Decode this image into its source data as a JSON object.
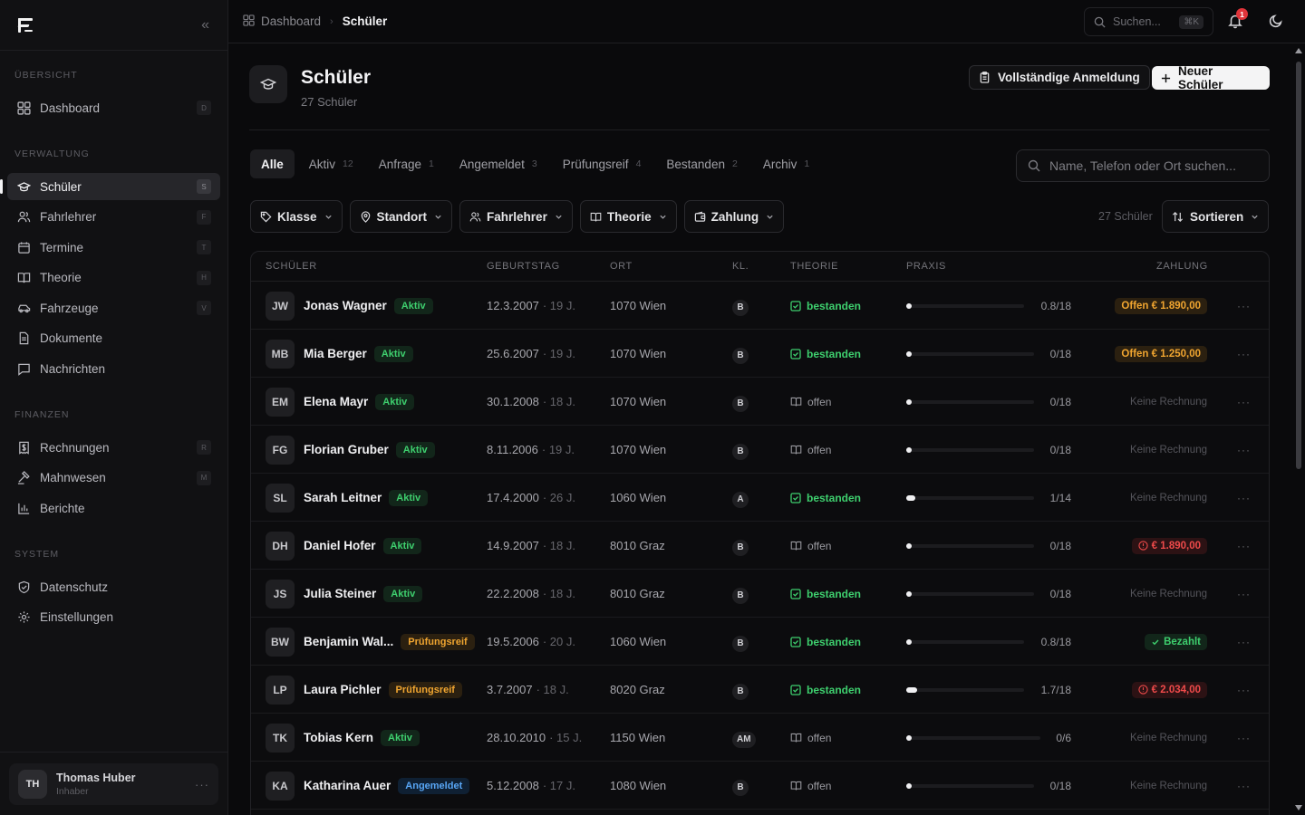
{
  "sidebar": {
    "sections": [
      {
        "label": "ÜBERSICHT",
        "items": [
          {
            "label": "Dashboard",
            "kbd": "D",
            "icon": "dashboard-icon"
          }
        ]
      },
      {
        "label": "VERWALTUNG",
        "items": [
          {
            "label": "Schüler",
            "kbd": "S",
            "icon": "graduation-cap-icon",
            "active": true
          },
          {
            "label": "Fahrlehrer",
            "kbd": "F",
            "icon": "user-icon"
          },
          {
            "label": "Termine",
            "kbd": "T",
            "icon": "calendar-icon"
          },
          {
            "label": "Theorie",
            "kbd": "H",
            "icon": "book-icon"
          },
          {
            "label": "Fahrzeuge",
            "kbd": "V",
            "icon": "car-icon"
          },
          {
            "label": "Dokumente",
            "kbd": "",
            "icon": "document-icon"
          },
          {
            "label": "Nachrichten",
            "kbd": "",
            "icon": "message-icon"
          }
        ]
      },
      {
        "label": "FINANZEN",
        "items": [
          {
            "label": "Rechnungen",
            "kbd": "R",
            "icon": "receipt-icon"
          },
          {
            "label": "Mahnwesen",
            "kbd": "M",
            "icon": "gavel-icon"
          },
          {
            "label": "Berichte",
            "kbd": "",
            "icon": "bar-chart-icon"
          }
        ]
      },
      {
        "label": "SYSTEM",
        "items": [
          {
            "label": "Datenschutz",
            "kbd": "",
            "icon": "shield-icon"
          },
          {
            "label": "Einstellungen",
            "kbd": "",
            "icon": "gear-icon"
          }
        ]
      }
    ],
    "user": {
      "initials": "TH",
      "name": "Thomas Huber",
      "role": "Inhaber",
      "more": "···"
    }
  },
  "topbar": {
    "breadcrumb_root": "Dashboard",
    "breadcrumb_current": "Schüler",
    "search_placeholder": "Suchen...",
    "search_kbd": "⌘K",
    "notification_count": "1"
  },
  "page": {
    "title": "Schüler",
    "subtitle": "27 Schüler",
    "btn_full_registration": "Vollständige Anmeldung",
    "btn_new_student": "Neuer Schüler"
  },
  "tabs": [
    {
      "label": "Alle",
      "count": "",
      "active": true
    },
    {
      "label": "Aktiv",
      "count": "12"
    },
    {
      "label": "Anfrage",
      "count": "1"
    },
    {
      "label": "Angemeldet",
      "count": "3"
    },
    {
      "label": "Prüfungsreif",
      "count": "4"
    },
    {
      "label": "Bestanden",
      "count": "2"
    },
    {
      "label": "Archiv",
      "count": "1"
    }
  ],
  "search_main_placeholder": "Name, Telefon oder Ort suchen...",
  "filters": [
    "Klasse",
    "Standort",
    "Fahrlehrer",
    "Theorie",
    "Zahlung"
  ],
  "result_count": "27 Schüler",
  "sort_label": "Sortieren",
  "table": {
    "headers": [
      "SCHÜLER",
      "GEBURTSTAG",
      "ORT",
      "KL.",
      "THEORIE",
      "PRAXIS",
      "ZAHLUNG"
    ],
    "rows": [
      {
        "initials": "JW",
        "name": "Jonas Wagner",
        "status": "Aktiv",
        "status_type": "aktiv",
        "birth": "12.3.2007",
        "age": "· 19 J.",
        "ort": "1070 Wien",
        "kl": "B",
        "theorie": "bestanden",
        "theorie_ok": true,
        "praxis": "0.8/18",
        "praxis_progress": 0.044,
        "zahlung": "Offen € 1.890,00",
        "zahlung_type": "open"
      },
      {
        "initials": "MB",
        "name": "Mia Berger",
        "status": "Aktiv",
        "status_type": "aktiv",
        "birth": "25.6.2007",
        "age": "· 19 J.",
        "ort": "1070 Wien",
        "kl": "B",
        "theorie": "bestanden",
        "theorie_ok": true,
        "praxis": "0/18",
        "praxis_progress": 0,
        "zahlung": "Offen € 1.250,00",
        "zahlung_type": "open"
      },
      {
        "initials": "EM",
        "name": "Elena Mayr",
        "status": "Aktiv",
        "status_type": "aktiv",
        "birth": "30.1.2008",
        "age": "· 18 J.",
        "ort": "1070 Wien",
        "kl": "B",
        "theorie": "offen",
        "theorie_ok": false,
        "praxis": "0/18",
        "praxis_progress": 0,
        "zahlung": "Keine Rechnung",
        "zahlung_type": "none"
      },
      {
        "initials": "FG",
        "name": "Florian Gruber",
        "status": "Aktiv",
        "status_type": "aktiv",
        "birth": "8.11.2006",
        "age": "· 19 J.",
        "ort": "1070 Wien",
        "kl": "B",
        "theorie": "offen",
        "theorie_ok": false,
        "praxis": "0/18",
        "praxis_progress": 0,
        "zahlung": "Keine Rechnung",
        "zahlung_type": "none"
      },
      {
        "initials": "SL",
        "name": "Sarah Leitner",
        "status": "Aktiv",
        "status_type": "aktiv",
        "birth": "17.4.2000",
        "age": "· 26 J.",
        "ort": "1060 Wien",
        "kl": "A",
        "theorie": "bestanden",
        "theorie_ok": true,
        "praxis": "1/14",
        "praxis_progress": 0.071,
        "zahlung": "Keine Rechnung",
        "zahlung_type": "none"
      },
      {
        "initials": "DH",
        "name": "Daniel Hofer",
        "status": "Aktiv",
        "status_type": "aktiv",
        "birth": "14.9.2007",
        "age": "· 18 J.",
        "ort": "8010 Graz",
        "kl": "B",
        "theorie": "offen",
        "theorie_ok": false,
        "praxis": "0/18",
        "praxis_progress": 0,
        "zahlung": "€ 1.890,00",
        "zahlung_type": "overdue"
      },
      {
        "initials": "JS",
        "name": "Julia Steiner",
        "status": "Aktiv",
        "status_type": "aktiv",
        "birth": "22.2.2008",
        "age": "· 18 J.",
        "ort": "8010 Graz",
        "kl": "B",
        "theorie": "bestanden",
        "theorie_ok": true,
        "praxis": "0/18",
        "praxis_progress": 0,
        "zahlung": "Keine Rechnung",
        "zahlung_type": "none"
      },
      {
        "initials": "BW",
        "name": "Benjamin Wal...",
        "status": "Prüfungsreif",
        "status_type": "pruef",
        "birth": "19.5.2006",
        "age": "· 20 J.",
        "ort": "1060 Wien",
        "kl": "B",
        "theorie": "bestanden",
        "theorie_ok": true,
        "praxis": "0.8/18",
        "praxis_progress": 0.044,
        "zahlung": "Bezahlt",
        "zahlung_type": "paid"
      },
      {
        "initials": "LP",
        "name": "Laura Pichler",
        "status": "Prüfungsreif",
        "status_type": "pruef",
        "birth": "3.7.2007",
        "age": "· 18 J.",
        "ort": "8020 Graz",
        "kl": "B",
        "theorie": "bestanden",
        "theorie_ok": true,
        "praxis": "1.7/18",
        "praxis_progress": 0.094,
        "zahlung": "€ 2.034,00",
        "zahlung_type": "overdue"
      },
      {
        "initials": "TK",
        "name": "Tobias Kern",
        "status": "Aktiv",
        "status_type": "aktiv",
        "birth": "28.10.2010",
        "age": "· 15 J.",
        "ort": "1150 Wien",
        "kl": "AM",
        "theorie": "offen",
        "theorie_ok": false,
        "praxis": "0/6",
        "praxis_progress": 0,
        "zahlung": "Keine Rechnung",
        "zahlung_type": "none"
      },
      {
        "initials": "KA",
        "name": "Katharina Auer",
        "status": "Angemeldet",
        "status_type": "angem",
        "birth": "5.12.2008",
        "age": "· 17 J.",
        "ort": "1080 Wien",
        "kl": "B",
        "theorie": "offen",
        "theorie_ok": false,
        "praxis": "0/18",
        "praxis_progress": 0,
        "zahlung": "Keine Rechnung",
        "zahlung_type": "none"
      }
    ]
  }
}
